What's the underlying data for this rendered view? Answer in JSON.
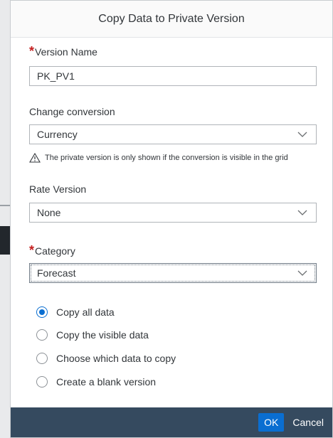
{
  "dialog": {
    "title": "Copy Data to Private Version"
  },
  "version_name": {
    "label": "Version Name",
    "required_mark": "*",
    "value": "PK_PV1"
  },
  "change_conversion": {
    "label": "Change conversion",
    "selected": "Currency"
  },
  "note": {
    "text": "The private version is only shown if the conversion is visible in the grid",
    "icon": "warning-triangle-icon"
  },
  "rate_version": {
    "label": "Rate Version",
    "selected": "None"
  },
  "category": {
    "label": "Category",
    "required_mark": "*",
    "selected": "Forecast"
  },
  "copy_options": [
    {
      "label": "Copy all data",
      "checked": true
    },
    {
      "label": "Copy the visible data",
      "checked": false
    },
    {
      "label": "Choose which data to copy",
      "checked": false
    },
    {
      "label": "Create a blank version",
      "checked": false
    }
  ],
  "footer": {
    "ok_label": "OK",
    "cancel_label": "Cancel"
  },
  "colors": {
    "accent": "#0a6ed1",
    "footer_bg": "#354a5f",
    "required": "#c41e1e"
  }
}
